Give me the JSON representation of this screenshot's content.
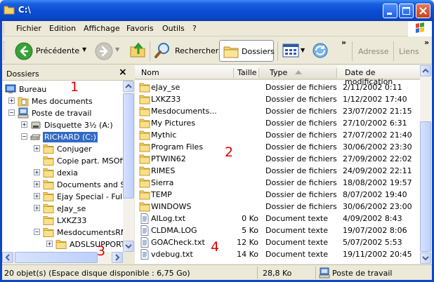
{
  "window": {
    "title": "C:\\"
  },
  "menu": {
    "items": [
      "Fichier",
      "Edition",
      "Affichage",
      "Favoris",
      "Outils",
      "?"
    ]
  },
  "toolbar": {
    "back_label": "Précédente",
    "search_label": "Rechercher",
    "folders_label": "Dossiers",
    "address_label": "Adresse",
    "links_label": "Liens",
    "more": "»"
  },
  "folder_pane": {
    "title": "Dossiers",
    "close": "×",
    "tree": [
      {
        "label": "Bureau",
        "icon": "desktop-icon"
      },
      {
        "label": "Mes documents",
        "icon": "mydocs-icon"
      },
      {
        "label": "Poste de travail",
        "icon": "computer-icon"
      },
      {
        "label": "Disquette 3½ (A:)",
        "icon": "floppy-icon"
      },
      {
        "label": "RICHARD (C:)",
        "icon": "drive-icon"
      },
      {
        "label": "Conjuger",
        "icon": "folder-icon"
      },
      {
        "label": "Copie part. MSOffi",
        "icon": "folder-icon"
      },
      {
        "label": "dexia",
        "icon": "folder-icon"
      },
      {
        "label": "Documents and Se",
        "icon": "folder-icon"
      },
      {
        "label": "Ejay Special - Full",
        "icon": "folder-icon"
      },
      {
        "label": "eJay_se",
        "icon": "folder-icon"
      },
      {
        "label": "LXKZ33",
        "icon": "folder-icon"
      },
      {
        "label": "MesdocumentsRM",
        "icon": "folder-icon"
      },
      {
        "label": "ADSLSUPPORT",
        "icon": "folder-icon"
      }
    ]
  },
  "columns": {
    "name": "Nom",
    "size": "Taille",
    "type": "Type",
    "date": "Date de modification"
  },
  "files": [
    {
      "name": "eJay_se",
      "size": "",
      "type": "Dossier de fichiers",
      "date": "2/11/2002 0:11",
      "icon": "folder-icon"
    },
    {
      "name": "LXKZ33",
      "size": "",
      "type": "Dossier de fichiers",
      "date": "1/12/2002 17:40",
      "icon": "folder-icon"
    },
    {
      "name": "Mesdocuments...",
      "size": "",
      "type": "Dossier de fichiers",
      "date": "23/07/2002 21:15",
      "icon": "folder-icon"
    },
    {
      "name": "My Pictures",
      "size": "",
      "type": "Dossier de fichiers",
      "date": "27/10/2002 6:31",
      "icon": "folder-icon"
    },
    {
      "name": "Mythic",
      "size": "",
      "type": "Dossier de fichiers",
      "date": "27/07/2002 21:40",
      "icon": "folder-icon"
    },
    {
      "name": "Program Files",
      "size": "",
      "type": "Dossier de fichiers",
      "date": "30/06/2002 23:30",
      "icon": "folder-icon"
    },
    {
      "name": "PTWIN62",
      "size": "",
      "type": "Dossier de fichiers",
      "date": "27/09/2002 22:02",
      "icon": "folder-icon"
    },
    {
      "name": "RIMES",
      "size": "",
      "type": "Dossier de fichiers",
      "date": "24/09/2002 22:11",
      "icon": "folder-icon"
    },
    {
      "name": "Sierra",
      "size": "",
      "type": "Dossier de fichiers",
      "date": "18/08/2002 19:57",
      "icon": "folder-icon"
    },
    {
      "name": "TEMP",
      "size": "",
      "type": "Dossier de fichiers",
      "date": "8/07/2002 19:40",
      "icon": "folder-icon"
    },
    {
      "name": "WINDOWS",
      "size": "",
      "type": "Dossier de fichiers",
      "date": "30/06/2002 23:00",
      "icon": "folder-icon"
    },
    {
      "name": "AILog.txt",
      "size": "0 Ko",
      "type": "Document texte",
      "date": "4/09/2002 8:43",
      "icon": "text-file-icon"
    },
    {
      "name": "CLDMA.LOG",
      "size": "5 Ko",
      "type": "Document texte",
      "date": "19/07/2002 8:06",
      "icon": "text-file-icon"
    },
    {
      "name": "GOACheck.txt",
      "size": "12 Ko",
      "type": "Document texte",
      "date": "5/07/2002 5:53",
      "icon": "text-file-icon"
    },
    {
      "name": "vdebug.txt",
      "size": "14 Ko",
      "type": "Document texte",
      "date": "19/11/2002 20:45",
      "icon": "text-file-icon"
    }
  ],
  "annotations": [
    "1",
    "2",
    "3",
    "4"
  ],
  "status": {
    "objects": "20 objet(s) (Espace disque disponible : 6,75 Go)",
    "size": "28,8 Ko",
    "location": "Poste de travail"
  },
  "colors": {
    "titlebar": "#0a47c9",
    "selection": "#316ac5",
    "folder": "#f4d36b",
    "annotation": "#e00000"
  }
}
